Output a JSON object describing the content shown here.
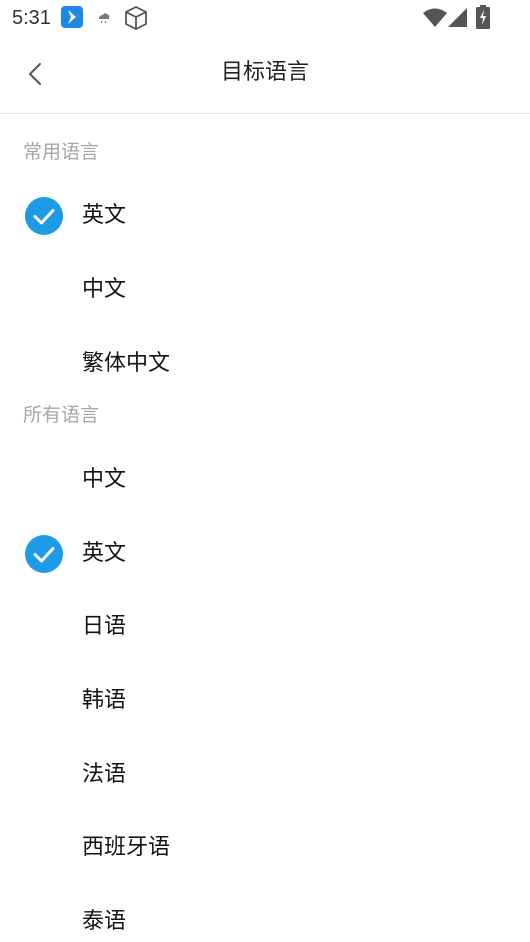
{
  "status_bar": {
    "time": "5:31",
    "icons": [
      "app-notification-icon",
      "weather-icon",
      "cube-icon",
      "wifi-icon",
      "cell-signal-icon",
      "battery-charging-icon"
    ]
  },
  "header": {
    "title": "目标语言",
    "back_icon": "chevron-left-icon"
  },
  "sections": {
    "common": {
      "title": "常用语言",
      "items": [
        {
          "label": "英文",
          "selected": true
        },
        {
          "label": "中文",
          "selected": false
        },
        {
          "label": "繁体中文",
          "selected": false
        }
      ]
    },
    "all": {
      "title": "所有语言",
      "items": [
        {
          "label": "中文",
          "selected": false
        },
        {
          "label": "英文",
          "selected": true
        },
        {
          "label": "日语",
          "selected": false
        },
        {
          "label": "韩语",
          "selected": false
        },
        {
          "label": "法语",
          "selected": false
        },
        {
          "label": "西班牙语",
          "selected": false
        },
        {
          "label": "泰语",
          "selected": false
        }
      ]
    }
  },
  "colors": {
    "accent": "#1e9be6",
    "section_text": "#a6a6a6",
    "divider": "#e8e8e8"
  }
}
